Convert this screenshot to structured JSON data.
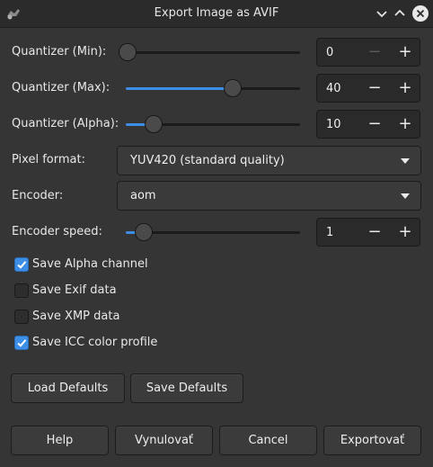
{
  "window": {
    "title": "Export Image as AVIF",
    "controls": [
      "minimize-icon",
      "maximize-icon",
      "close-icon"
    ]
  },
  "quantizer_min": {
    "label": "Quantizer (Min):",
    "value": "0",
    "slider_fraction": 0.0,
    "minus_disabled": true
  },
  "quantizer_max": {
    "label": "Quantizer (Max):",
    "value": "40",
    "slider_fraction": 0.635
  },
  "quantizer_alpha": {
    "label": "Quantizer (Alpha):",
    "value": "10",
    "slider_fraction": 0.159
  },
  "pixel_format": {
    "label": "Pixel format:",
    "value": "YUV420 (standard quality)"
  },
  "encoder": {
    "label": "Encoder:",
    "value": "aom"
  },
  "encoder_speed": {
    "label": "Encoder speed:",
    "value": "1",
    "slider_fraction": 0.1
  },
  "checkboxes": [
    {
      "label": "Save Alpha channel",
      "checked": true
    },
    {
      "label": "Save Exif data",
      "checked": false
    },
    {
      "label": "Save XMP data",
      "checked": false
    },
    {
      "label": "Save ICC color profile",
      "checked": true
    }
  ],
  "defaults": {
    "load": "Load Defaults",
    "save": "Save Defaults"
  },
  "actions": {
    "help": "Help",
    "reset": "Vynulovať",
    "cancel": "Cancel",
    "export": "Exportovať"
  },
  "colors": {
    "accent": "#3d8ee6",
    "background": "#353535"
  }
}
